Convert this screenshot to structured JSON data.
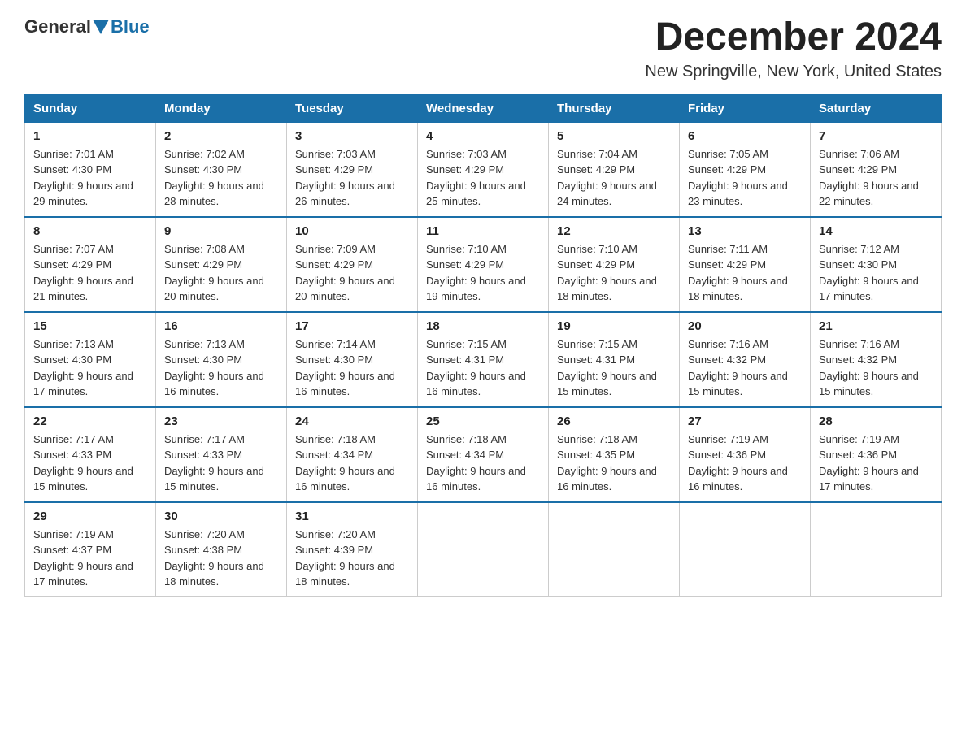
{
  "header": {
    "logo_general": "General",
    "logo_blue": "Blue",
    "title": "December 2024",
    "subtitle": "New Springville, New York, United States"
  },
  "weekdays": [
    "Sunday",
    "Monday",
    "Tuesday",
    "Wednesday",
    "Thursday",
    "Friday",
    "Saturday"
  ],
  "weeks": [
    [
      {
        "day": "1",
        "sunrise": "7:01 AM",
        "sunset": "4:30 PM",
        "daylight": "9 hours and 29 minutes"
      },
      {
        "day": "2",
        "sunrise": "7:02 AM",
        "sunset": "4:30 PM",
        "daylight": "9 hours and 28 minutes"
      },
      {
        "day": "3",
        "sunrise": "7:03 AM",
        "sunset": "4:29 PM",
        "daylight": "9 hours and 26 minutes"
      },
      {
        "day": "4",
        "sunrise": "7:03 AM",
        "sunset": "4:29 PM",
        "daylight": "9 hours and 25 minutes"
      },
      {
        "day": "5",
        "sunrise": "7:04 AM",
        "sunset": "4:29 PM",
        "daylight": "9 hours and 24 minutes"
      },
      {
        "day": "6",
        "sunrise": "7:05 AM",
        "sunset": "4:29 PM",
        "daylight": "9 hours and 23 minutes"
      },
      {
        "day": "7",
        "sunrise": "7:06 AM",
        "sunset": "4:29 PM",
        "daylight": "9 hours and 22 minutes"
      }
    ],
    [
      {
        "day": "8",
        "sunrise": "7:07 AM",
        "sunset": "4:29 PM",
        "daylight": "9 hours and 21 minutes"
      },
      {
        "day": "9",
        "sunrise": "7:08 AM",
        "sunset": "4:29 PM",
        "daylight": "9 hours and 20 minutes"
      },
      {
        "day": "10",
        "sunrise": "7:09 AM",
        "sunset": "4:29 PM",
        "daylight": "9 hours and 20 minutes"
      },
      {
        "day": "11",
        "sunrise": "7:10 AM",
        "sunset": "4:29 PM",
        "daylight": "9 hours and 19 minutes"
      },
      {
        "day": "12",
        "sunrise": "7:10 AM",
        "sunset": "4:29 PM",
        "daylight": "9 hours and 18 minutes"
      },
      {
        "day": "13",
        "sunrise": "7:11 AM",
        "sunset": "4:29 PM",
        "daylight": "9 hours and 18 minutes"
      },
      {
        "day": "14",
        "sunrise": "7:12 AM",
        "sunset": "4:30 PM",
        "daylight": "9 hours and 17 minutes"
      }
    ],
    [
      {
        "day": "15",
        "sunrise": "7:13 AM",
        "sunset": "4:30 PM",
        "daylight": "9 hours and 17 minutes"
      },
      {
        "day": "16",
        "sunrise": "7:13 AM",
        "sunset": "4:30 PM",
        "daylight": "9 hours and 16 minutes"
      },
      {
        "day": "17",
        "sunrise": "7:14 AM",
        "sunset": "4:30 PM",
        "daylight": "9 hours and 16 minutes"
      },
      {
        "day": "18",
        "sunrise": "7:15 AM",
        "sunset": "4:31 PM",
        "daylight": "9 hours and 16 minutes"
      },
      {
        "day": "19",
        "sunrise": "7:15 AM",
        "sunset": "4:31 PM",
        "daylight": "9 hours and 15 minutes"
      },
      {
        "day": "20",
        "sunrise": "7:16 AM",
        "sunset": "4:32 PM",
        "daylight": "9 hours and 15 minutes"
      },
      {
        "day": "21",
        "sunrise": "7:16 AM",
        "sunset": "4:32 PM",
        "daylight": "9 hours and 15 minutes"
      }
    ],
    [
      {
        "day": "22",
        "sunrise": "7:17 AM",
        "sunset": "4:33 PM",
        "daylight": "9 hours and 15 minutes"
      },
      {
        "day": "23",
        "sunrise": "7:17 AM",
        "sunset": "4:33 PM",
        "daylight": "9 hours and 15 minutes"
      },
      {
        "day": "24",
        "sunrise": "7:18 AM",
        "sunset": "4:34 PM",
        "daylight": "9 hours and 16 minutes"
      },
      {
        "day": "25",
        "sunrise": "7:18 AM",
        "sunset": "4:34 PM",
        "daylight": "9 hours and 16 minutes"
      },
      {
        "day": "26",
        "sunrise": "7:18 AM",
        "sunset": "4:35 PM",
        "daylight": "9 hours and 16 minutes"
      },
      {
        "day": "27",
        "sunrise": "7:19 AM",
        "sunset": "4:36 PM",
        "daylight": "9 hours and 16 minutes"
      },
      {
        "day": "28",
        "sunrise": "7:19 AM",
        "sunset": "4:36 PM",
        "daylight": "9 hours and 17 minutes"
      }
    ],
    [
      {
        "day": "29",
        "sunrise": "7:19 AM",
        "sunset": "4:37 PM",
        "daylight": "9 hours and 17 minutes"
      },
      {
        "day": "30",
        "sunrise": "7:20 AM",
        "sunset": "4:38 PM",
        "daylight": "9 hours and 18 minutes"
      },
      {
        "day": "31",
        "sunrise": "7:20 AM",
        "sunset": "4:39 PM",
        "daylight": "9 hours and 18 minutes"
      },
      null,
      null,
      null,
      null
    ]
  ]
}
